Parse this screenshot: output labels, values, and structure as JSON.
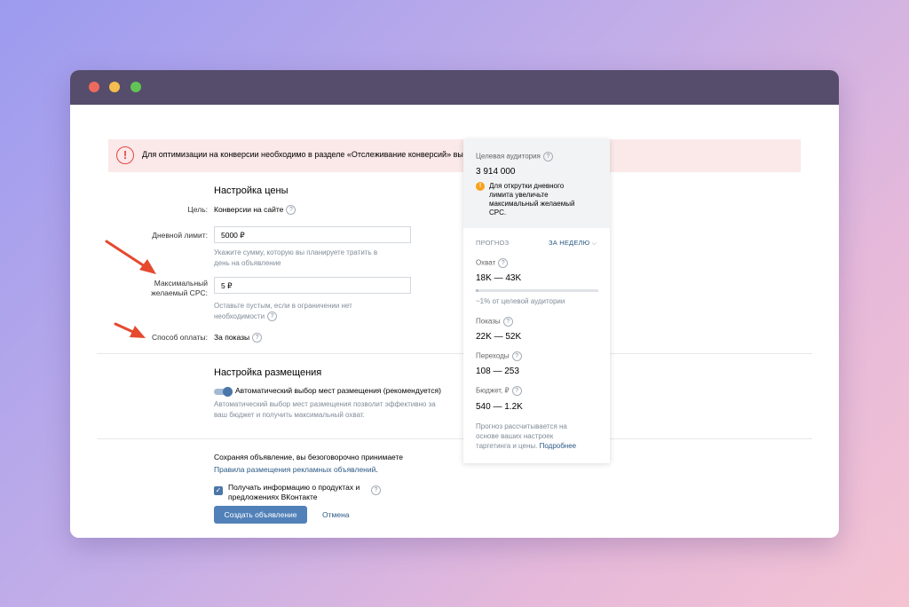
{
  "alert": {
    "text": "Для оптимизации на конверсии необходимо в разделе «Отслеживание конверсий» выберите"
  },
  "price": {
    "section_title": "Настройка цены",
    "goal_label": "Цель:",
    "goal_value": "Конверсии на сайте",
    "daily_limit_label": "Дневной лимит:",
    "daily_limit_value": "5000 ₽",
    "daily_limit_hint_1": "Укажите сумму, которую вы планируете тратить в",
    "daily_limit_hint_2": "день на объявление",
    "max_cpc_label_1": "Максимальный",
    "max_cpc_label_2": "желаемый CPC:",
    "max_cpc_value": "5 ₽",
    "max_cpc_hint_1": "Оставьте пустым, если в ограничении нет",
    "max_cpc_hint_2": "необходимости",
    "payment_label": "Способ оплаты:",
    "payment_value": "За показы"
  },
  "placement": {
    "section_title": "Настройка размещения",
    "auto_label": "Автоматический выбор мест размещения (рекомендуется)",
    "auto_hint_1": "Автоматический выбор мест размещения позволит эффективно за",
    "auto_hint_2": "ваш бюджет и получить максимальный охват."
  },
  "footer": {
    "agree_text": "Сохраняя объявление, вы безоговорочно принимаете",
    "rules_link": "Правила размещения рекламных объявлений",
    "rules_dot": ".",
    "subscribe_1": "Получать информацию о продуктах и",
    "subscribe_2": "предложениях ВКонтакте",
    "create_button": "Создать объявление",
    "cancel_link": "Отмена"
  },
  "panel": {
    "audience_label": "Целевая аудитория",
    "audience_value": "3 914 000",
    "warning_1": "Для открутки дневного",
    "warning_2": "лимита увеличьте",
    "warning_3": "максимальный желаемый",
    "warning_4": "CPC.",
    "forecast_label": "ПРОГНОЗ",
    "period_label": "ЗА НЕДЕЛЮ",
    "reach_label": "Охват",
    "reach_value": "18K — 43K",
    "reach_share": 0.01,
    "reach_note": "~1% от целевой аудитории",
    "impressions_label": "Показы",
    "impressions_value": "22K — 52K",
    "clicks_label": "Переходы",
    "clicks_value": "108 — 253",
    "budget_label": "Бюджет, ₽",
    "budget_value": "540 — 1.2K",
    "note_1": "Прогноз рассчитывается на",
    "note_2": "основе ваших настроек",
    "note_3": "таргетинга и цены.",
    "note_link": "Подробнее"
  },
  "colors": {
    "accent": "#5181b8",
    "link": "#2a5885",
    "alert_bg": "#fbe8e8",
    "alert_icon": "#e64646",
    "warning": "#f8a01c",
    "annotation_arrow": "#e5492e"
  }
}
